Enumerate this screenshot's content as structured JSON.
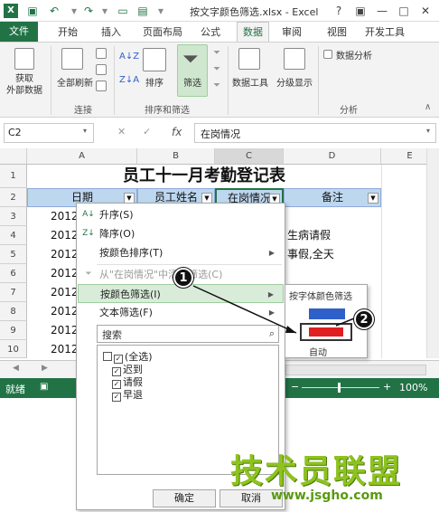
{
  "window": {
    "title": "按文字颜色筛选.xlsx - Excel",
    "help": "?",
    "minimize": "—",
    "restore": "□",
    "close": "✕"
  },
  "tabs": [
    "文件",
    "开始",
    "插入",
    "页面布局",
    "公式",
    "数据",
    "审阅",
    "视图",
    "开发工具"
  ],
  "ribbon": {
    "get_external": "获取\n外部数据",
    "refresh_all": "全部刷新",
    "group_connections": "连接",
    "sort_az": "A↓Z",
    "sort_za": "Z↓A",
    "sort": "排序",
    "filter": "筛选",
    "group_sort_filter": "排序和筛选",
    "data_tools": "数据工具",
    "outline": "分级显示",
    "data_analysis": "数据分析",
    "group_analysis": "分析"
  },
  "formula_bar": {
    "name_box": "C2",
    "fx": "fx",
    "content": "在岗情况",
    "cancel": "✕",
    "enter": "✓"
  },
  "grid": {
    "columns": [
      "A",
      "B",
      "C",
      "D",
      "E"
    ],
    "rows": [
      "1",
      "2",
      "3",
      "4",
      "5",
      "6",
      "7",
      "8",
      "9",
      "10"
    ],
    "title": "员工十一月考勤登记表",
    "headers": [
      "日期",
      "员工姓名",
      "在岗情况",
      "备注"
    ],
    "col_a": [
      "2012",
      "2012",
      "2012",
      "2012",
      "2012",
      "2012",
      "2012",
      "2012"
    ],
    "col_d": [
      "生病请假",
      "事假,全天"
    ]
  },
  "status": {
    "ready": "就绪",
    "zoom": "100%",
    "zoom_minus": "−",
    "zoom_plus": "+"
  },
  "menu": {
    "sort_asc": "升序(S)",
    "sort_desc": "降序(O)",
    "sort_color": "按颜色排序(T)",
    "clear_filter": "从\"在岗情况\"中清除筛选(C)",
    "filter_color": "按颜色筛选(I)",
    "text_filter": "文本筛选(F)",
    "search_placeholder": "搜索",
    "items": [
      "(全选)",
      "迟到",
      "请假",
      "早退"
    ],
    "ok": "确定",
    "cancel": "取消"
  },
  "submenu": {
    "title": "按字体颜色筛选",
    "auto": "自动",
    "colors": [
      "#2f5fc8",
      "#e02020"
    ]
  },
  "callouts": [
    "1",
    "2"
  ],
  "watermark": {
    "main": "技术员联盟",
    "url": "www.jsgho.com"
  }
}
